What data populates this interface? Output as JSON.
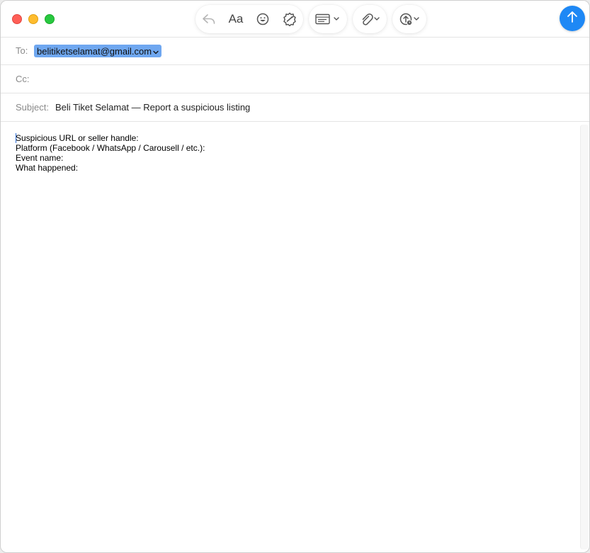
{
  "toolbar": {
    "format_label": "Aa",
    "icons": [
      "reply-icon",
      "format-icon",
      "emoji-icon",
      "photo-effects-icon",
      "header-fields-icon",
      "attachment-icon",
      "send-later-icon",
      "send-icon"
    ]
  },
  "header": {
    "to_label": "To:",
    "to_recipient": "belitiketselamat@gmail.com",
    "cc_label": "Cc:",
    "subject_label": "Subject:",
    "subject_value": "Beli Tiket Selamat — Report a suspicious listing"
  },
  "body": {
    "lines": [
      "Suspicious URL or seller handle:",
      "Platform (Facebook / WhatsApp / Carousell / etc.):",
      "Event name:",
      "What happened:"
    ]
  },
  "colors": {
    "accent": "#1e88f5",
    "token": "#6fa7f0",
    "close": "#ff5f57",
    "minimize": "#febc2e",
    "maximize": "#28c840"
  }
}
